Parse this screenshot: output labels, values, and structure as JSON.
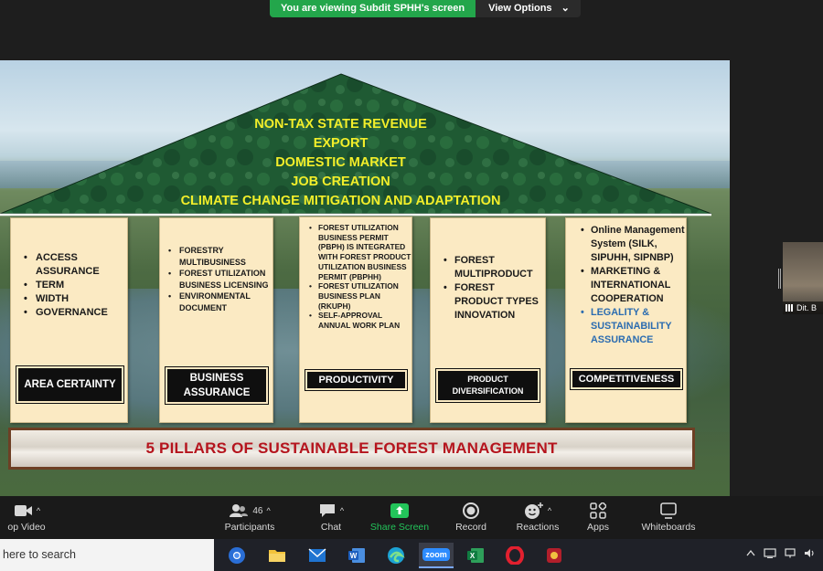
{
  "banner": {
    "message": "You are viewing Subdit SPHH's screen",
    "view_options": "View Options",
    "caret": "⌄"
  },
  "slide": {
    "roof_lines": [
      "NON-TAX STATE REVENUE",
      "EXPORT",
      "DOMESTIC MARKET",
      "JOB CREATION",
      "CLIMATE CHANGE MITIGATION AND ADAPTATION"
    ],
    "pillars": [
      {
        "items": [
          "ACCESS ASSURANCE",
          "TERM",
          "WIDTH",
          "GOVERNANCE"
        ],
        "label": "AREA CERTAINTY"
      },
      {
        "items": [
          "FORESTRY MULTIBUSINESS",
          "FOREST UTILIZATION BUSINESS LICENSING",
          "ENVIRONMENTAL DOCUMENT"
        ],
        "label": "BUSINESS ASSURANCE"
      },
      {
        "items": [
          "FOREST UTILIZATION BUSINESS PERMIT (PBPH) IS INTEGRATED WITH FOREST PRODUCT UTILIZATION BUSINESS PERMIT (PBPHH)",
          "FOREST UTILIZATION BUSINESS PLAN (RKUPH)",
          "SELF-APPROVAL ANNUAL WORK PLAN"
        ],
        "label": "PRODUCTIVITY"
      },
      {
        "items": [
          "FOREST MULTIPRODUCT",
          "FOREST PRODUCT TYPES INNOVATION"
        ],
        "label": "PRODUCT DIVERSIFICATION"
      },
      {
        "items": [
          "Online Management System (SILK, SIPUHH, SIPNBP)",
          "MARKETING & INTERNATIONAL COOPERATION",
          "LEGALITY & SUSTAINABILITY ASSURANCE"
        ],
        "label": "COMPETITIVENESS"
      }
    ],
    "footer": "5 PILLARS OF SUSTAINABLE FOREST MANAGEMENT",
    "colors": {
      "roof_text": "#f2ee2a",
      "footer_text": "#b5141d",
      "legal_text": "#2b6cb0",
      "pillar_bg": "#fbeac3"
    }
  },
  "side_video": {
    "name": "Dit. B"
  },
  "toolbar": {
    "video_label": "op Video",
    "participants_label": "Participants",
    "participants_count": "46",
    "chat_label": "Chat",
    "share_label": "Share Screen",
    "record_label": "Record",
    "reactions_label": "Reactions",
    "apps_label": "Apps",
    "whiteboards_label": "Whiteboards",
    "caret": "^"
  },
  "taskbar": {
    "search_placeholder": "here to search",
    "apps": [
      "chrome-icon",
      "file-explorer-icon",
      "mail-icon",
      "word-icon",
      "edge-icon",
      "zoom-icon",
      "excel-icon",
      "opera-icon",
      "app-icon"
    ],
    "zoom_label": "zoom"
  }
}
